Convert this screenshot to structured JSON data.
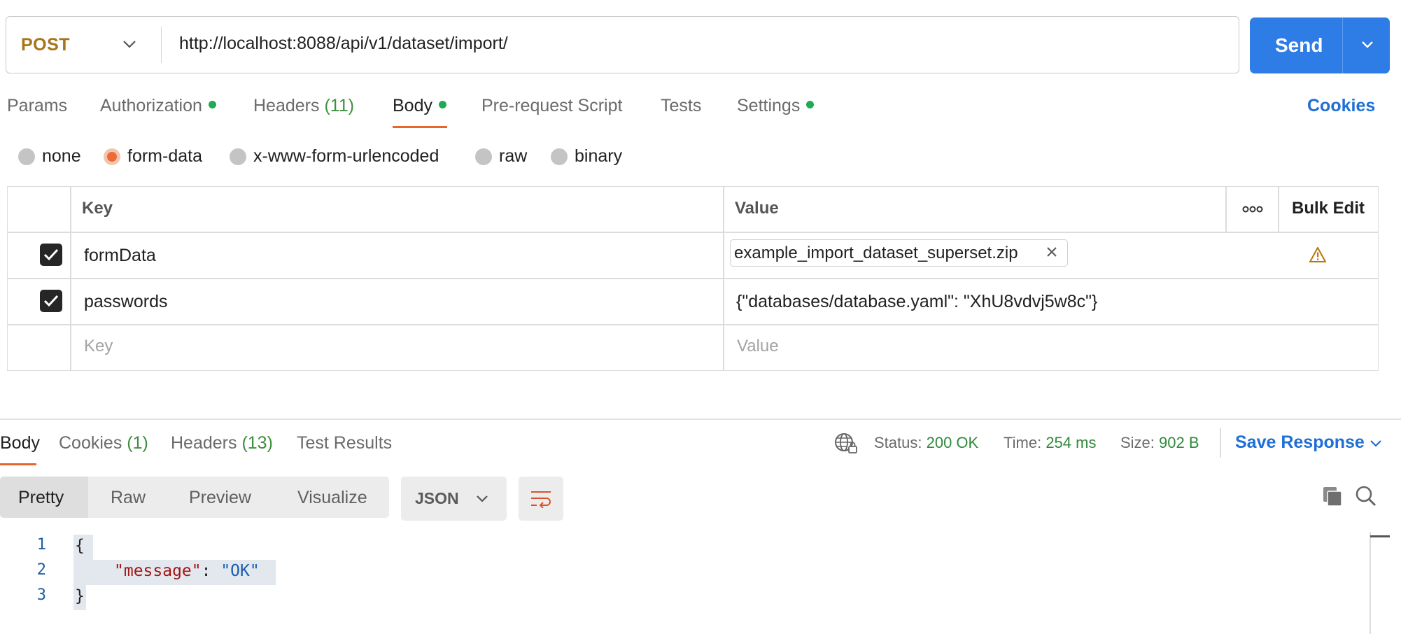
{
  "request": {
    "method": "POST",
    "url": "http://localhost:8088/api/v1/dataset/import/",
    "send_label": "Send"
  },
  "tabs": [
    {
      "label": "Params"
    },
    {
      "label": "Authorization",
      "dot": true
    },
    {
      "label": "Headers",
      "count": "(11)"
    },
    {
      "label": "Body",
      "dot": true,
      "active": true
    },
    {
      "label": "Pre-request Script"
    },
    {
      "label": "Tests"
    },
    {
      "label": "Settings",
      "dot": true
    }
  ],
  "cookies_link": "Cookies",
  "body_types": [
    {
      "label": "none"
    },
    {
      "label": "form-data",
      "selected": true
    },
    {
      "label": "x-www-form-urlencoded"
    },
    {
      "label": "raw"
    },
    {
      "label": "binary"
    }
  ],
  "table": {
    "headers": {
      "key": "Key",
      "value": "Value",
      "bulk_edit": "Bulk Edit"
    },
    "rows": [
      {
        "checked": true,
        "key": "formData",
        "value": "example_import_dataset_superset.zip",
        "value_type": "file",
        "warning_icon": "warning-icon"
      },
      {
        "checked": true,
        "key": "passwords",
        "value": "{\"databases/database.yaml\": \"XhU8vdvj5w8c\"}",
        "value_type": "text"
      }
    ],
    "placeholder": {
      "key": "Key",
      "value": "Value"
    }
  },
  "response": {
    "tabs": [
      {
        "label": "Body",
        "active": true
      },
      {
        "label": "Cookies",
        "count": "(1)"
      },
      {
        "label": "Headers",
        "count": "(13)"
      },
      {
        "label": "Test Results"
      }
    ],
    "status": {
      "label": "Status:",
      "value": "200 OK"
    },
    "time": {
      "label": "Time:",
      "value": "254 ms"
    },
    "size": {
      "label": "Size:",
      "value": "902 B"
    },
    "save_label": "Save Response",
    "view_modes": [
      {
        "label": "Pretty",
        "active": true
      },
      {
        "label": "Raw"
      },
      {
        "label": "Preview"
      },
      {
        "label": "Visualize"
      }
    ],
    "format": "JSON",
    "code_lines": [
      {
        "n": "1",
        "text": "{"
      },
      {
        "n": "2",
        "key": "\"message\"",
        "sep": ": ",
        "value": "\"OK\""
      },
      {
        "n": "3",
        "text": "}"
      }
    ]
  },
  "colors": {
    "accent_blue": "#2e7ce6",
    "method_post": "#a6741a",
    "active_tab_underline": "#e8652d",
    "status_green": "#2f8a3c",
    "dot_green": "#1faa55"
  }
}
